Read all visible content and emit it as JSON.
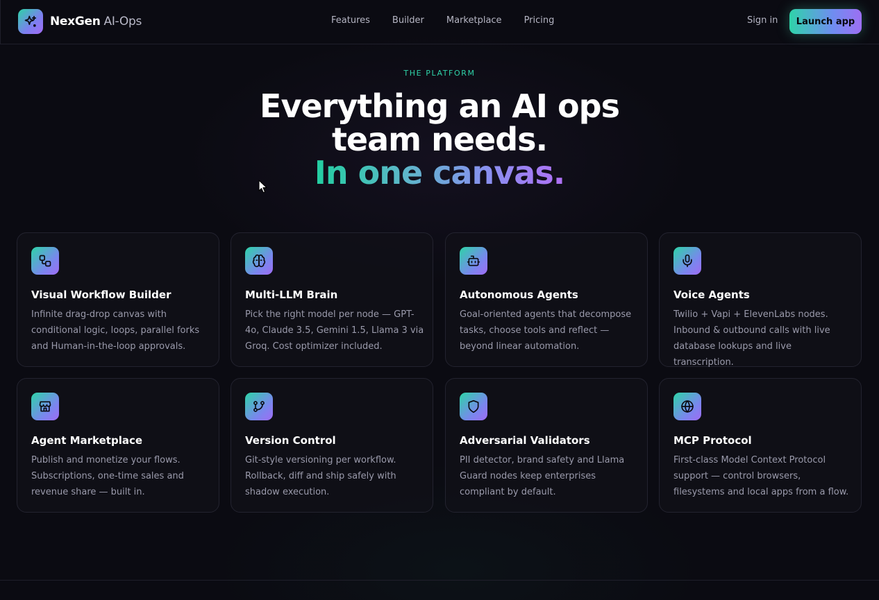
{
  "header": {
    "brand_name": "NexGen",
    "brand_suffix": "AI-Ops",
    "nav": [
      "Features",
      "Builder",
      "Marketplace",
      "Pricing"
    ],
    "sign_in": "Sign in",
    "launch": "Launch app"
  },
  "hero": {
    "eyebrow": "THE PLATFORM",
    "title": "Everything an AI ops team needs.",
    "accent": "In one canvas."
  },
  "features": [
    {
      "icon": "workflow-icon",
      "title": "Visual Workflow Builder",
      "desc": "Infinite drag-drop canvas with conditional logic, loops, parallel forks and Human-in-the-loop approvals."
    },
    {
      "icon": "brain-icon",
      "title": "Multi-LLM Brain",
      "desc": "Pick the right model per node — GPT-4o, Claude 3.5, Gemini 1.5, Llama 3 via Groq. Cost optimizer included."
    },
    {
      "icon": "bot-icon",
      "title": "Autonomous Agents",
      "desc": "Goal-oriented agents that decompose tasks, choose tools and reflect — beyond linear automation."
    },
    {
      "icon": "microphone-icon",
      "title": "Voice Agents",
      "desc": "Twilio + Vapi + ElevenLabs nodes. Inbound & outbound calls with live database lookups and live transcription."
    },
    {
      "icon": "store-icon",
      "title": "Agent Marketplace",
      "desc": "Publish and monetize your flows. Subscriptions, one-time sales and revenue share — built in."
    },
    {
      "icon": "git-branch-icon",
      "title": "Version Control",
      "desc": "Git-style versioning per workflow. Rollback, diff and ship safely with shadow execution."
    },
    {
      "icon": "shield-icon",
      "title": "Adversarial Validators",
      "desc": "PII detector, brand safety and Llama Guard nodes keep enterprises compliant by default."
    },
    {
      "icon": "globe-icon",
      "title": "MCP Protocol",
      "desc": "First-class Model Context Protocol support — control browsers, filesystems and local apps from a flow."
    }
  ],
  "colors": {
    "accent_teal": "#2fd3a9",
    "accent_purple": "#a26bf5",
    "background": "#0b0b12"
  }
}
